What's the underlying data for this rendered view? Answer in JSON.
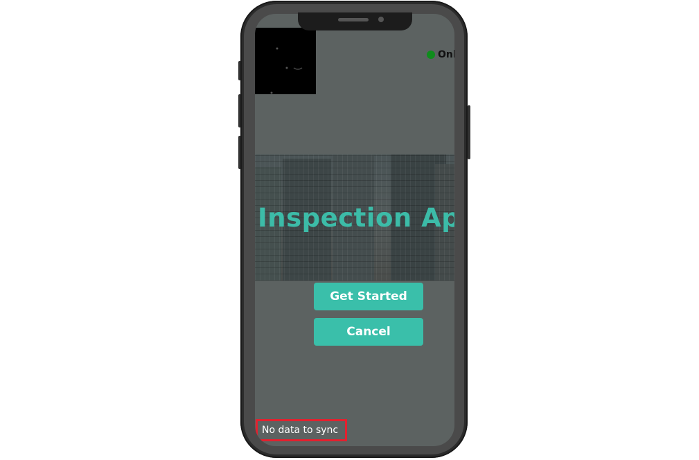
{
  "app": {
    "title": "Inspection Ap"
  },
  "status": {
    "label": "Onl",
    "indicator_color": "#0f8c1c"
  },
  "banner": {
    "title": "Inspection Ap",
    "title_color": "#3cbca8"
  },
  "actions": {
    "get_started_label": "Get Started",
    "cancel_label": "Cancel",
    "button_color": "#3abfaa"
  },
  "sync": {
    "message": "No data to sync",
    "highlight_color": "#e4202e"
  },
  "icons": {
    "logo": "logo-icon",
    "status": "status-dot-icon"
  }
}
